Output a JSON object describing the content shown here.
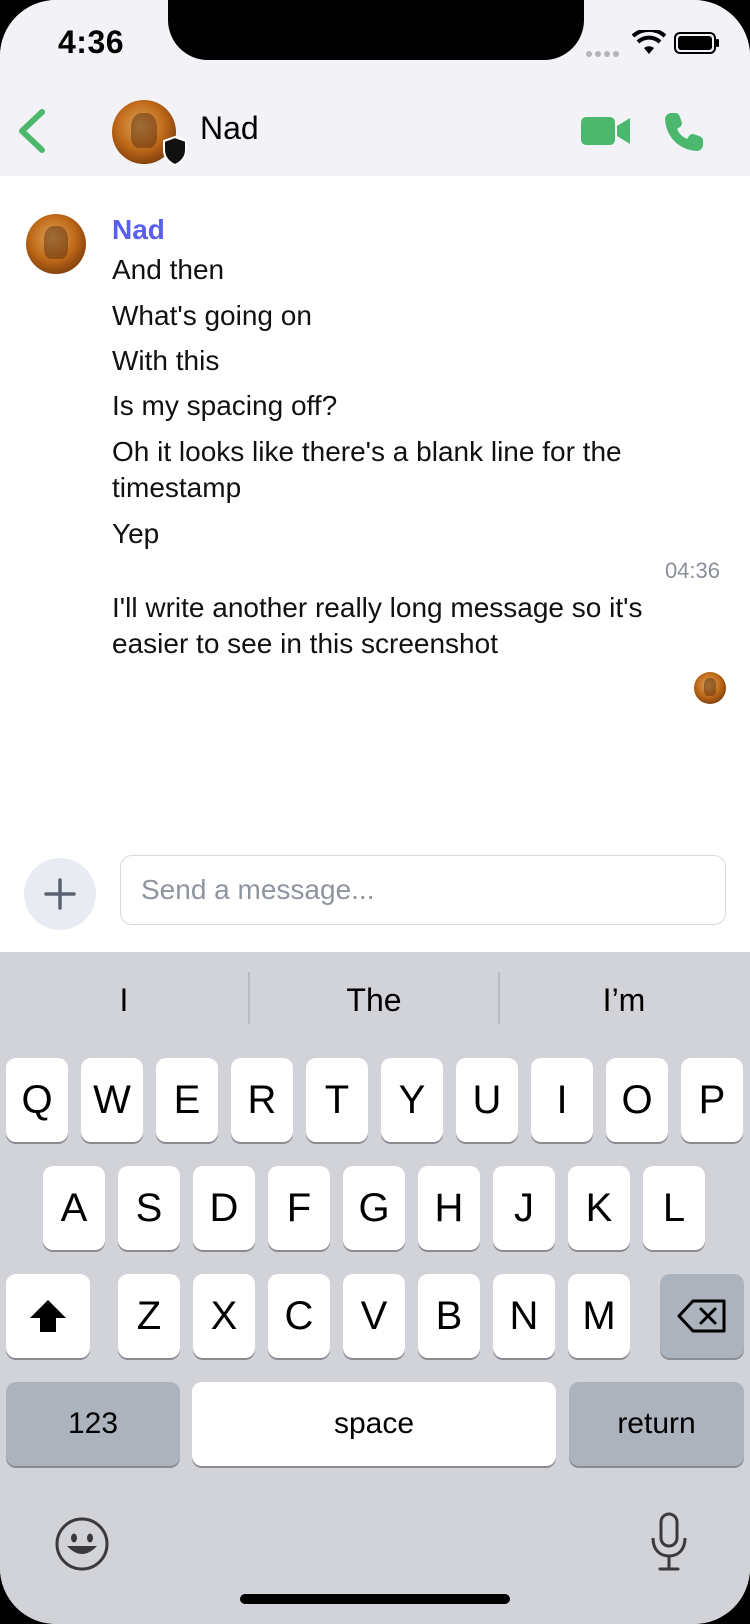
{
  "status": {
    "time": "4:36"
  },
  "header": {
    "name": "Nad",
    "icons": [
      "back-chevron-icon",
      "shield-icon",
      "video-call-icon",
      "phone-icon"
    ]
  },
  "colors": {
    "accent": "#4cb86e",
    "sender": "#5a5ff0"
  },
  "messages": {
    "sender": "Nad",
    "lines": [
      "And then",
      "What's going on",
      "With this",
      "Is my spacing off?",
      "Oh it looks like there's a blank line for the timestamp",
      "Yep"
    ],
    "timestamp": "04:36",
    "last": "I'll write another really long message so it's easier to see in this screenshot"
  },
  "composer": {
    "placeholder": "Send a message..."
  },
  "keyboard": {
    "suggestions": [
      "I",
      "The",
      "I’m"
    ],
    "row1": [
      "Q",
      "W",
      "E",
      "R",
      "T",
      "Y",
      "U",
      "I",
      "O",
      "P"
    ],
    "row2": [
      "A",
      "S",
      "D",
      "F",
      "G",
      "H",
      "J",
      "K",
      "L"
    ],
    "row3": [
      "Z",
      "X",
      "C",
      "V",
      "B",
      "N",
      "M"
    ],
    "numbers": "123",
    "space": "space",
    "return": "return"
  }
}
